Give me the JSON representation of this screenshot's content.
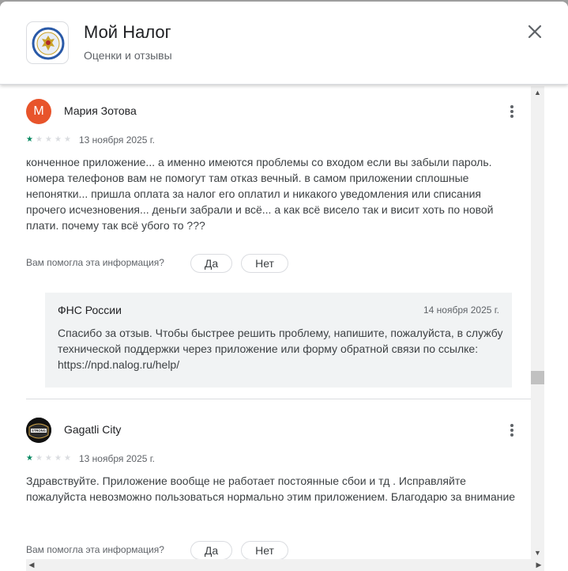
{
  "dialog": {
    "title": "Мой Налог",
    "subtitle": "Оценки и отзывы"
  },
  "helpful_question": "Вам помогла эта информация?",
  "yes_label": "Да",
  "no_label": "Нет",
  "reviews": [
    {
      "author": "Мария Зотова",
      "avatar_letter": "М",
      "avatar_color": "#e8542b",
      "rating": 1,
      "date": "13 ноября 2025 г.",
      "text": "конченное приложение... а именно имеются проблемы со входом если вы забыли пароль. номера телефонов вам не помогут там отказ вечный. в самом приложении сплошные непонятки... пришла оплата за налог его оплатил и никакого уведомления или списания прочего исчезновения... деньги забрали и всё... а как всё висело так и висит хоть по новой плати. почему так всё убого то ???",
      "developer_reply": {
        "name": "ФНС России",
        "date": "14 ноября 2025 г.",
        "text": "Спасибо за отзыв. Чтобы быстрее решить проблему, напишите, пожалуйста, в службу технической поддержки через приложение или форму обратной связи по ссылке: https://npd.nalog.ru/help/"
      }
    },
    {
      "author": "Gagatli City",
      "avatar_logo_text": "STRONG",
      "rating": 1,
      "date": "13 ноября 2025 г.",
      "text": "Здравствуйте. Приложение вообще не работает постоянные сбои и тд . Исправляйте пожалуйста невозможно пользоваться нормально этим приложением. Благодарю за внимание"
    }
  ],
  "colors": {
    "star_filled": "#01875f",
    "star_empty": "#dadce0",
    "reply_bg": "#f1f3f4"
  }
}
